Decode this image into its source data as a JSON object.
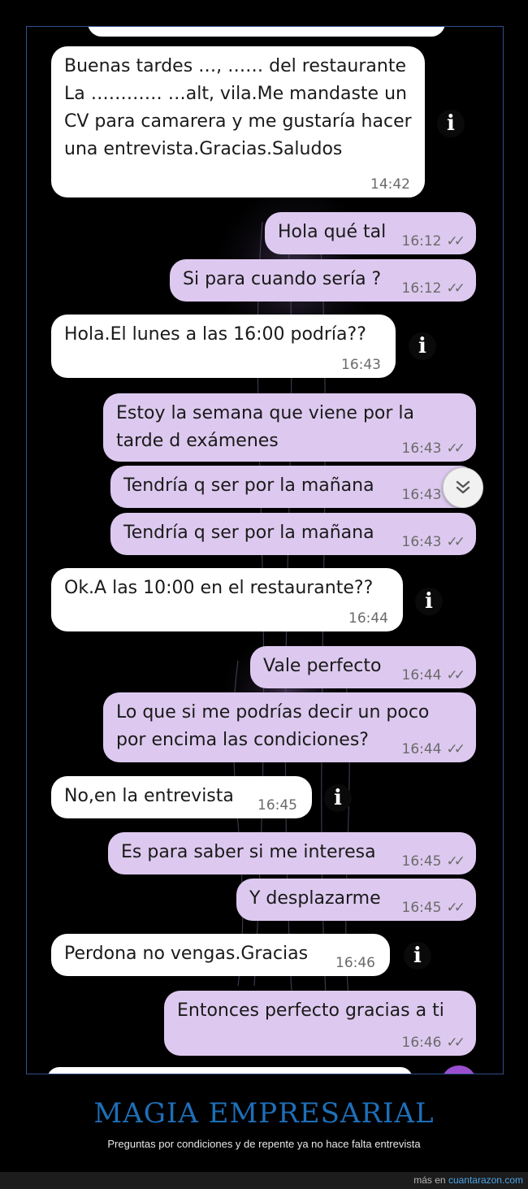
{
  "chat": {
    "messages": [
      {
        "text": "Buenas tardes …, …… del restaurante La ………… …alt, vila.Me mandaste un CV para camarera y me gustaría hacer una entrevista.Gracias.Saludos",
        "time": "14:42"
      },
      {
        "text": "Hola qué tal",
        "time": "16:12"
      },
      {
        "text": "Si para cuando sería ?",
        "time": "16:12"
      },
      {
        "text": "Hola.El lunes a las 16:00 podría??",
        "time": "16:43"
      },
      {
        "text": "Estoy la semana que viene por la tarde d exámenes",
        "time": "16:43"
      },
      {
        "text": "Tendría q ser por la mañana",
        "time": "16:43"
      },
      {
        "text": "Tendría q ser por la mañana",
        "time": "16:43"
      },
      {
        "text": "Ok.A las 10:00 en el restaurante??",
        "time": "16:44"
      },
      {
        "text": "Vale perfecto",
        "time": "16:44"
      },
      {
        "text": "Lo que si me podrías decir un poco por encima las condiciones?",
        "time": "16:44"
      },
      {
        "text": "No,en la entrevista",
        "time": "16:45"
      },
      {
        "text": "Es para saber si me interesa",
        "time": "16:45"
      },
      {
        "text": "Y desplazarme",
        "time": "16:45"
      },
      {
        "text": "Perdona no vengas.Gracias",
        "time": "16:46"
      },
      {
        "text": "Entonces perfecto gracias a ti",
        "time": "16:46"
      }
    ],
    "info_glyph": "i",
    "read_ticks": "✓✓"
  },
  "caption": {
    "title": "MAGIA EMPRESARIAL",
    "subtitle": "Preguntas por condiciones y de repente ya no hace falta entrevista"
  },
  "footer": {
    "prefix": "más en",
    "site": "cuantarazon.com"
  },
  "colors": {
    "incoming_bubble": "#ffffff",
    "outgoing_bubble": "#ddc9ef",
    "background": "#000000",
    "caption_title": "#1e6fb8",
    "footer_link": "#4aa3e8"
  },
  "icons": [
    "info-icon",
    "double-check-icon",
    "chevron-down-icon",
    "jellyfish-background"
  ]
}
